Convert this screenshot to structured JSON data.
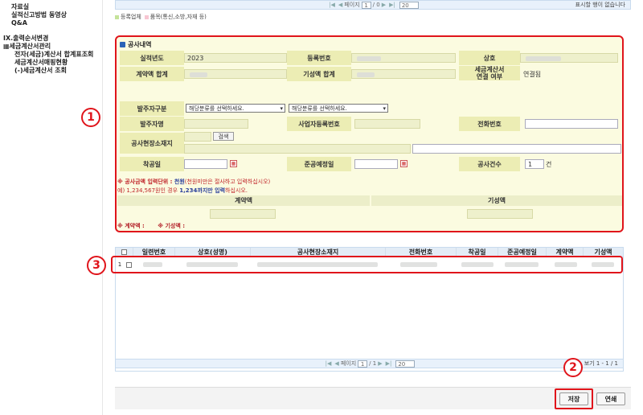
{
  "sidebar": {
    "items": [
      "자료실",
      "실적신고방법 동영상",
      "Q&A",
      "IX.출력순서변경",
      "▦세금계산서관리",
      "전자(세금)계산서 합계표조회",
      "세금계산서매핑현황",
      "(-)세금계산서 조회"
    ]
  },
  "top_pager": {
    "page_label": "페이지",
    "page_value": "1",
    "page_total": "/ 0",
    "page_size": "20",
    "status": "표시할 행이 없습니다"
  },
  "legend": {
    "item1": "등록업체",
    "item2": "품목(통신,소방,자재 등)"
  },
  "section": {
    "title": "공사내역",
    "labels": {
      "year": "실적년도",
      "reg_no": "등록번호",
      "company": "상호",
      "contract_total": "계약액 합계",
      "progress_total": "기성액 합계",
      "tax_invoice_link": "세금계산서\n연결 여부",
      "client_type": "발주자구분",
      "client_name": "발주자명",
      "biz_no": "사업자등록번호",
      "phone": "전화번호",
      "site_address": "공사현장소재지",
      "start_date": "착공일",
      "completion_date": "준공예정일",
      "count": "공사건수"
    },
    "values": {
      "year": "2023",
      "tax_invoice_link": "연결됨",
      "count": "1",
      "count_unit": "건"
    },
    "select_placeholder": "해당분류를 선택하세요.",
    "search_button": "검색",
    "note1_prefix": "※ 공사금액 입력단위 : ",
    "note1_unit": "천원",
    "note1_suffix": "(천원미만은 절사하고 입력하십시오)",
    "note2_prefix": "예) 1,234,567원인 경우 ",
    "note2_hl": "1,234까지만 입력",
    "note2_suffix": "하십시오.",
    "sum_contract_header": "계약액",
    "sum_progress_header": "기성액",
    "sum_footer_contract": "※ 계약액 :",
    "sum_footer_progress": "※ 기성액 :"
  },
  "grid": {
    "columns": [
      "일련번호",
      "상호(성명)",
      "공사현장소재지",
      "전화번호",
      "착공일",
      "준공예정일",
      "계약액",
      "기성액"
    ],
    "row_number": "1"
  },
  "bottom_pager": {
    "page_label": "페이지",
    "page_value": "1",
    "page_total": "/ 1",
    "page_size": "20",
    "status": "보기 1 - 1 / 1"
  },
  "actions": {
    "save": "저장",
    "delete": "연쇄"
  },
  "markers": {
    "one": "1",
    "two": "2",
    "three": "3"
  },
  "colors": {
    "highlight_red": "#e0141b",
    "label_bg": "#ecedb4",
    "section_bg": "#fbfbe0"
  }
}
